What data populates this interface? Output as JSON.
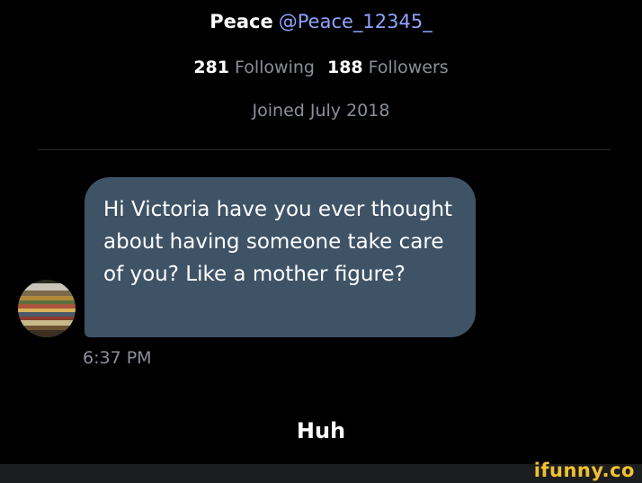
{
  "profile": {
    "display_name": "Peace",
    "handle": "@Peace_12345_",
    "following_count": "281",
    "following_label": "Following",
    "followers_count": "188",
    "followers_label": "Followers",
    "joined": "Joined July 2018"
  },
  "conversation": {
    "messages": [
      {
        "text": "Hi Victoria have you ever thought about having someone take care of you? Like a mother figure?",
        "time": "6:37 PM"
      }
    ],
    "reply": "Huh"
  },
  "watermark": "ifunny.co",
  "colors": {
    "background": "#000000",
    "bubble": "#3f5366",
    "handle": "#8fa3ff",
    "muted_text": "#8a9099",
    "watermark": "#f2c12e"
  }
}
